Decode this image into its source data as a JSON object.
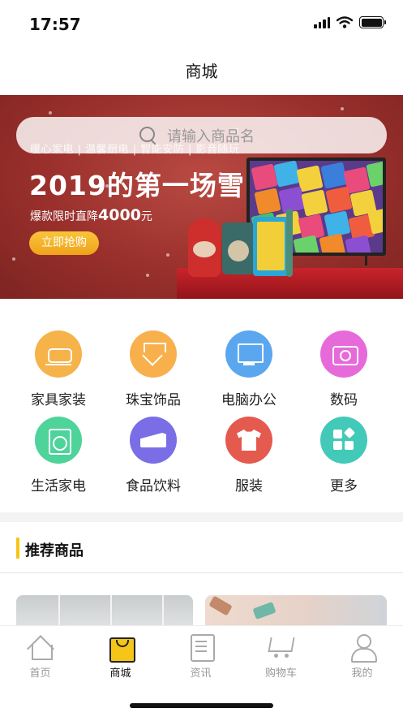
{
  "status_bar": {
    "time": "17:57"
  },
  "nav": {
    "title": "商城"
  },
  "banner": {
    "search_placeholder": "请输入商品名",
    "tags": "暖心家电 | 温馨厨电 | 智能安防 | 影音随玩",
    "headline": "2019的第一场雪",
    "sub_prefix": "爆款限时直降",
    "sub_amount": "4000",
    "sub_suffix": "元",
    "cta": "立即抢购"
  },
  "categories": [
    {
      "label": "家具家装",
      "icon": "sofa-icon",
      "color": "#f5b34a"
    },
    {
      "label": "珠宝饰品",
      "icon": "diamond-icon",
      "color": "#f7b04c"
    },
    {
      "label": "电脑办公",
      "icon": "monitor-icon",
      "color": "#5aa7f0"
    },
    {
      "label": "数码",
      "icon": "camera-icon",
      "color": "#e66ad9"
    },
    {
      "label": "生活家电",
      "icon": "washer-icon",
      "color": "#4ed39a"
    },
    {
      "label": "食品饮料",
      "icon": "cake-icon",
      "color": "#7a6ee6"
    },
    {
      "label": "服装",
      "icon": "shirt-icon",
      "color": "#e55a4e"
    },
    {
      "label": "更多",
      "icon": "more-icon",
      "color": "#43c9b8"
    }
  ],
  "section": {
    "title": "推荐商品",
    "accent": "#f5c518"
  },
  "tabs": [
    {
      "label": "首页",
      "icon": "home-icon",
      "active": false
    },
    {
      "label": "商城",
      "icon": "shopping-bag-icon",
      "active": true
    },
    {
      "label": "资讯",
      "icon": "news-icon",
      "active": false
    },
    {
      "label": "购物车",
      "icon": "cart-icon",
      "active": false
    },
    {
      "label": "我的",
      "icon": "user-icon",
      "active": false
    }
  ]
}
